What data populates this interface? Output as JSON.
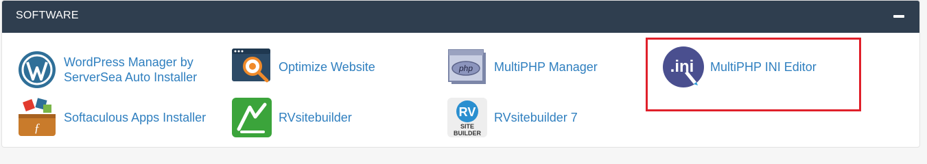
{
  "section": {
    "title": "SOFTWARE",
    "collapse_icon": "minus-icon"
  },
  "items": [
    {
      "label": "WordPress Manager by ServerSea Auto Installer",
      "icon": "wordpress-icon"
    },
    {
      "label": "Optimize Website",
      "icon": "optimize-website-icon"
    },
    {
      "label": "MultiPHP Manager",
      "icon": "php-icon"
    },
    {
      "label": "MultiPHP INI Editor",
      "icon": "ini-editor-icon"
    },
    {
      "label": "Softaculous Apps Installer",
      "icon": "softaculous-icon"
    },
    {
      "label": "RVsitebuilder",
      "icon": "rvsitebuilder-icon"
    },
    {
      "label": "RVsitebuilder 7",
      "icon": "rvsitebuilder7-icon"
    }
  ],
  "icon_text": {
    "php": "php",
    "ini": ".ini",
    "rv": "RV",
    "site_builder_line1": "SITE",
    "site_builder_line2": "BUILDER"
  },
  "highlight": {
    "target": "MultiPHP INI Editor",
    "color": "#e0202a"
  },
  "colors": {
    "header_bg": "#2f3e4f",
    "link": "#2f7fbf"
  }
}
